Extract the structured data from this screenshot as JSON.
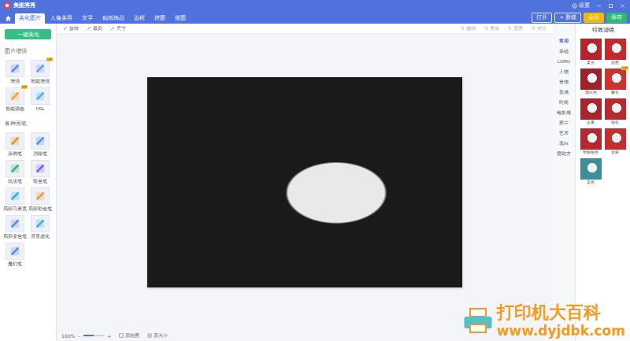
{
  "app": {
    "title": "美图秀秀",
    "settings": "设置"
  },
  "tabs": [
    {
      "label": "美化图片",
      "selected": true
    },
    {
      "label": "人像美容",
      "selected": false
    },
    {
      "label": "文字",
      "selected": false
    },
    {
      "label": "贴纸饰品",
      "selected": false
    },
    {
      "label": "边框",
      "selected": false
    },
    {
      "label": "拼图",
      "selected": false
    },
    {
      "label": "抠图",
      "selected": false
    }
  ],
  "actions": [
    {
      "label": "打开",
      "color": "#ffffff"
    },
    {
      "label": "+ 新建",
      "color": "#ffffff"
    },
    {
      "label": "会员",
      "color": "#f5b800"
    },
    {
      "label": "保存",
      "color": "#2dbb6e"
    }
  ],
  "toolbar": {
    "left": [
      "旋转",
      "裁剪",
      "尺寸"
    ],
    "right": [
      {
        "label": "撤销",
        "disabled": true
      },
      {
        "label": "重做",
        "disabled": true
      },
      {
        "label": "原图",
        "disabled": true
      },
      {
        "label": "对比",
        "disabled": true
      }
    ]
  },
  "left_panel": {
    "one_click": "一键美化",
    "vip_badge": "VIP",
    "sections": [
      {
        "title": "图片增强",
        "tools": [
          {
            "label": "增强",
            "vip": false,
            "color": "#5b8def"
          },
          {
            "label": "智能增强",
            "vip": true,
            "color": "#6aa0f5"
          },
          {
            "label": "智能调色",
            "vip": true,
            "color": "#f0a640"
          },
          {
            "label": "HSL",
            "vip": false,
            "color": "#4fb3e8"
          }
        ]
      },
      {
        "title": "各种画笔",
        "tools": [
          {
            "label": "涂鸦笔",
            "vip": false,
            "color": "#e9962e"
          },
          {
            "label": "消除笔",
            "vip": false,
            "color": "#5b8def"
          },
          {
            "label": "玩法笔",
            "vip": false,
            "color": "#3fb46a"
          },
          {
            "label": "取色笔",
            "vip": false,
            "color": "#8a5cf0"
          },
          {
            "label": "局部马赛克",
            "vip": false,
            "color": "#3aaee0"
          },
          {
            "label": "局部彩色笔",
            "vip": false,
            "color": "#e9a23b"
          },
          {
            "label": "局部变色笔",
            "vip": false,
            "color": "#5b8def"
          },
          {
            "label": "背景虚化",
            "vip": false,
            "color": "#38b6d6"
          },
          {
            "label": "魔幻笔",
            "vip": false,
            "color": "#5b8def"
          }
        ]
      }
    ]
  },
  "canvas": {
    "zoom": "100%",
    "minus": "–",
    "plus": "+",
    "zoom_level": 0.5,
    "fit": "原始图",
    "actual": "原大小"
  },
  "categories": [
    {
      "label": "常用",
      "selected": true
    },
    {
      "label": "基础",
      "selected": false
    },
    {
      "label": "LOMO",
      "selected": false
    },
    {
      "label": "人物",
      "selected": false
    },
    {
      "label": "食物",
      "selected": false
    },
    {
      "label": "质感",
      "selected": false
    },
    {
      "label": "时尚",
      "selected": false
    },
    {
      "label": "电影感",
      "selected": false
    },
    {
      "label": "胶片",
      "selected": false
    },
    {
      "label": "艺术",
      "selected": false
    },
    {
      "label": "黑白",
      "selected": false
    },
    {
      "label": "赞助方",
      "selected": false
    }
  ],
  "effects": {
    "title": "特效滤镜",
    "items": [
      {
        "label": "柔光",
        "vip": false,
        "color": "#b3242c"
      },
      {
        "label": "自然",
        "vip": false,
        "color": "#c22a30"
      },
      {
        "label": "黑白色",
        "vip": false,
        "color": "#9e2228"
      },
      {
        "label": "暖化",
        "vip": true,
        "color": "#c8352e"
      },
      {
        "label": "去雾",
        "vip": false,
        "color": "#a8262b"
      },
      {
        "label": "锐化",
        "vip": false,
        "color": "#b82a2f"
      },
      {
        "label": "智能绘色",
        "vip": false,
        "color": "#b5282d"
      },
      {
        "label": "全彩",
        "vip": false,
        "color": "#c0302f"
      },
      {
        "label": "反色",
        "vip": false,
        "color": "#3c8f96"
      }
    ]
  },
  "watermark": {
    "title": "打印机大百科",
    "url": "www.dyjdbk.com"
  }
}
